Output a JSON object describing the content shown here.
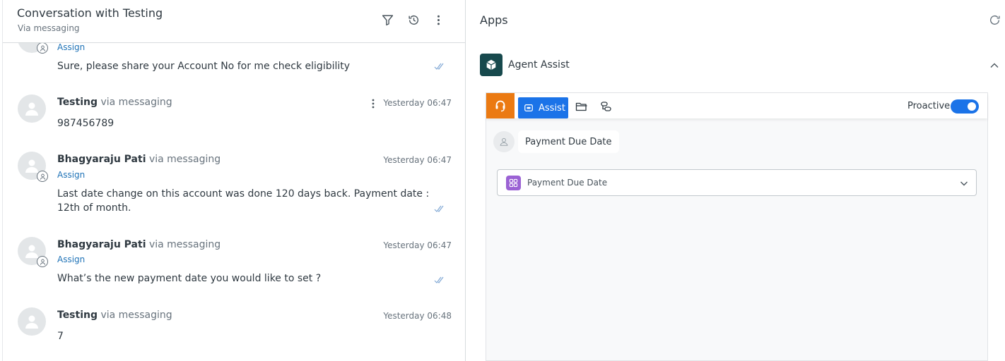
{
  "conversation": {
    "title": "Conversation with Testing",
    "subtitle": "Via messaging",
    "messages": [
      {
        "assign": "Assign",
        "text": "Sure, please share your Account No for me check eligibility"
      },
      {
        "sender": "Testing",
        "via": "via messaging",
        "time": "Yesterday 06:47",
        "text": "987456789"
      },
      {
        "sender": "Bhagyaraju Pati",
        "via": "via messaging",
        "time": "Yesterday 06:47",
        "assign": "Assign",
        "text": "Last date change on this account was done 120 days back. Payment date : 12th of month."
      },
      {
        "sender": "Bhagyaraju Pati",
        "via": "via messaging",
        "time": "Yesterday 06:47",
        "assign": "Assign",
        "text": "What’s the new payment date you would like to set ?"
      },
      {
        "sender": "Testing",
        "via": "via messaging",
        "time": "Yesterday 06:48",
        "text": "7"
      }
    ]
  },
  "apps": {
    "title": "Apps",
    "app_name": "Agent Assist",
    "widget": {
      "assist_label": "Assist",
      "proactive_label": "Proactive",
      "proactive_on": true,
      "user_query": "Payment Due Date",
      "dropdown_value": "Payment Due Date"
    }
  },
  "colors": {
    "accent_blue": "#1b73e8",
    "orange": "#eb7a12",
    "link_blue": "#1f73b7",
    "app_logo": "#17494d",
    "intent_purple": "#9b62d4"
  },
  "icons": [
    "filter-icon",
    "history-icon",
    "more-vertical-icon",
    "refresh-icon",
    "chevron-up-icon",
    "headset-icon",
    "folder-icon",
    "workflow-icon",
    "chevron-down-icon",
    "read-receipt-icon",
    "user-icon",
    "agent-icon"
  ]
}
